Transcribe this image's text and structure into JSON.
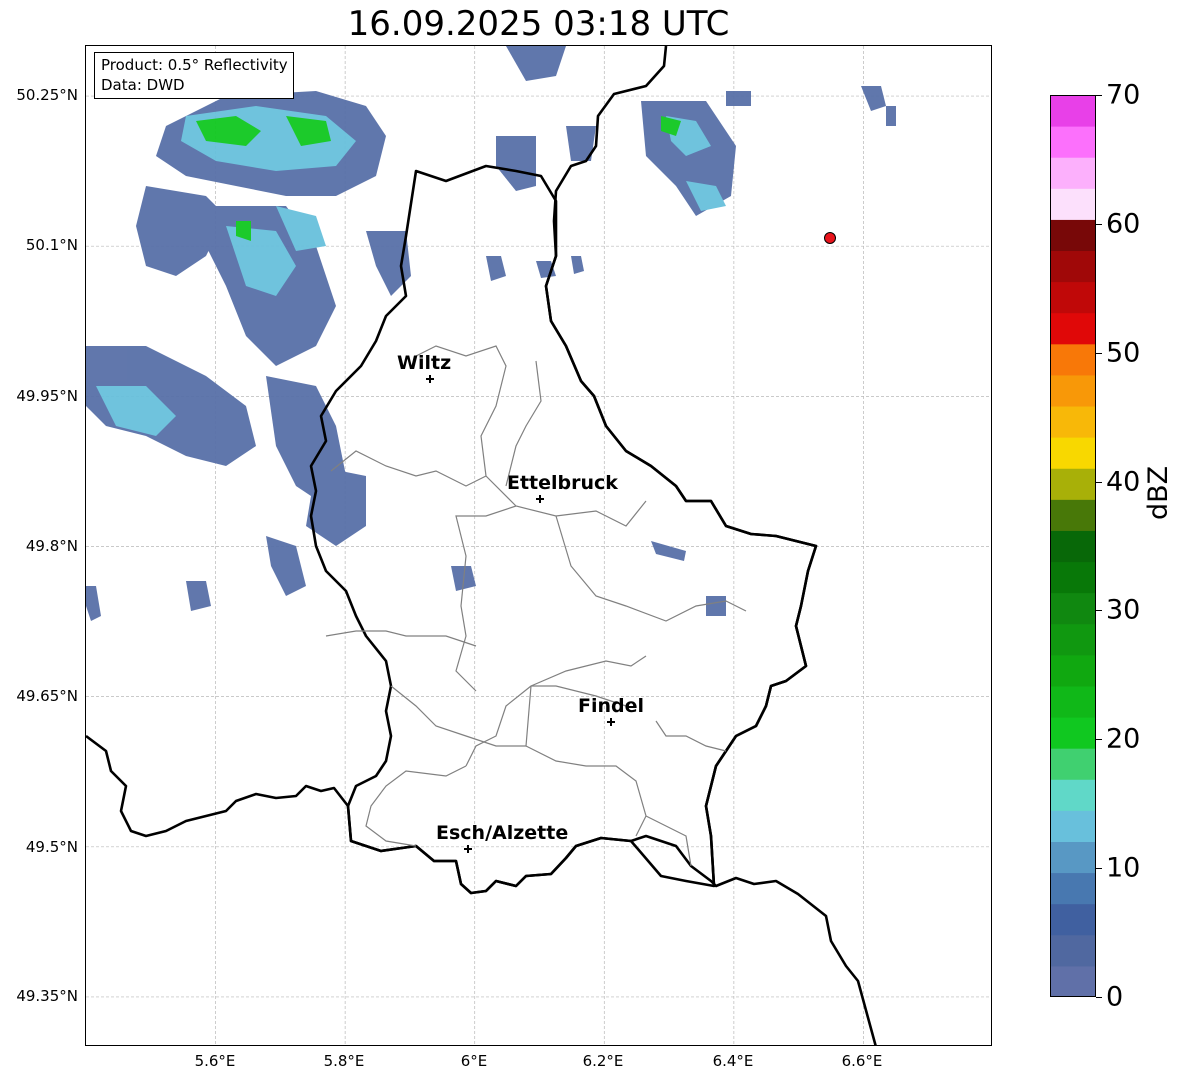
{
  "title": "16.09.2025 03:18 UTC",
  "info": {
    "product": "Product: 0.5° Reflectivity",
    "source": "Data: DWD"
  },
  "axes": {
    "lon_ticks": [
      "5.6°E",
      "5.8°E",
      "6°E",
      "6.2°E",
      "6.4°E",
      "6.6°E"
    ],
    "lat_ticks": [
      "50.25°N",
      "50.1°N",
      "49.95°N",
      "49.8°N",
      "49.65°N",
      "49.5°N",
      "49.35°N"
    ],
    "lon_range": [
      5.4,
      6.8
    ],
    "lat_range": [
      49.3,
      50.3
    ],
    "grid": true
  },
  "cities": [
    {
      "name": "Wiltz"
    },
    {
      "name": "Ettelbruck"
    },
    {
      "name": "Findel"
    },
    {
      "name": "Esch/Alzette"
    }
  ],
  "marker": {
    "color": "#e8141c"
  },
  "colorbar": {
    "label": "dBZ",
    "ticks": [
      "0",
      "10",
      "20",
      "30",
      "40",
      "50",
      "60",
      "70"
    ],
    "min": 0,
    "max": 70,
    "colors": [
      "#6070a8",
      "#5068a0",
      "#4060a0",
      "#4878b0",
      "#5898c4",
      "#68c0dc",
      "#60d8c8",
      "#40d070",
      "#10c820",
      "#10b818",
      "#10a810",
      "#109810",
      "#108810",
      "#087808",
      "#086808",
      "#487808",
      "#a8b008",
      "#f8d800",
      "#f8b808",
      "#f89808",
      "#f87808",
      "#e00808",
      "#c00808",
      "#a00808",
      "#780808",
      "#fce0fc",
      "#fcb0fc",
      "#fc70fc",
      "#e840e8"
    ]
  }
}
